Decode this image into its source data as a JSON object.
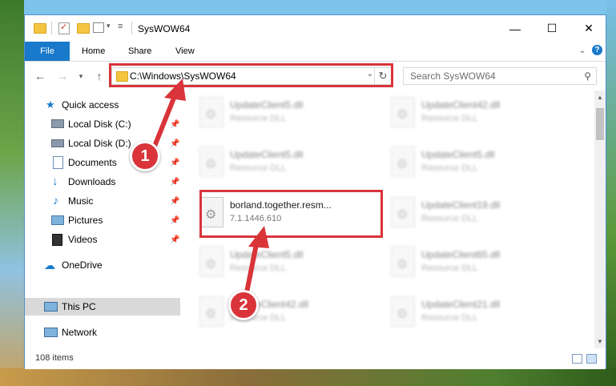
{
  "window": {
    "title": "SysWOW64",
    "controls": {
      "minimize": "—",
      "maximize": "☐",
      "close": "✕"
    }
  },
  "ribbon": {
    "tabs": [
      "File",
      "Home",
      "Share",
      "View"
    ],
    "help": "?"
  },
  "navigation": {
    "address": "C:\\Windows\\SysWOW64",
    "search_placeholder": "Search SysWOW64"
  },
  "sidebar": {
    "items": [
      {
        "label": "Quick access",
        "icon": "star-icon"
      },
      {
        "label": "Local Disk (C:)",
        "icon": "drive-icon"
      },
      {
        "label": "Local Disk (D:)",
        "icon": "drive-icon"
      },
      {
        "label": "Documents",
        "icon": "documents-icon"
      },
      {
        "label": "Downloads",
        "icon": "download-icon"
      },
      {
        "label": "Music",
        "icon": "music-icon"
      },
      {
        "label": "Pictures",
        "icon": "pictures-icon"
      },
      {
        "label": "Videos",
        "icon": "videos-icon"
      },
      {
        "label": "OneDrive",
        "icon": "cloud-icon"
      },
      {
        "label": "This PC",
        "icon": "computer-icon"
      },
      {
        "label": "Network",
        "icon": "network-icon"
      }
    ]
  },
  "files": [
    {
      "name": "UpdateClient5.dll",
      "desc": "Resource DLL"
    },
    {
      "name": "UpdateClient42.dll",
      "desc": "Resource DLL"
    },
    {
      "name": "UpdateClient5.dll",
      "desc": "Resource DLL"
    },
    {
      "name": "UpdateClient5.dll",
      "desc": "Resource DLL"
    },
    {
      "name": "borland.together.resm...",
      "desc": "7.1.1446.610"
    },
    {
      "name": "UpdateClient19.dll",
      "desc": "Resource DLL"
    },
    {
      "name": "UpdateClient5.dll",
      "desc": "Resource DLL"
    },
    {
      "name": "UpdateClient65.dll",
      "desc": "Resource DLL"
    },
    {
      "name": "UpdateClient42.dll",
      "desc": "Resource DLL"
    },
    {
      "name": "UpdateClient21.dll",
      "desc": "Resource DLL"
    }
  ],
  "status": {
    "item_count": "108 items"
  },
  "callouts": {
    "step1": "1",
    "step2": "2"
  },
  "colors": {
    "accent": "#1979ca",
    "highlight": "#d9343a"
  }
}
